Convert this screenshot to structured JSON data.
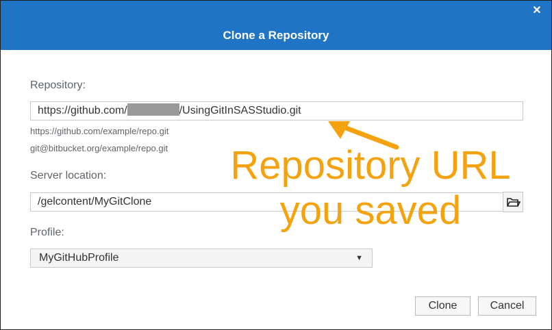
{
  "dialog": {
    "title": "Clone a Repository",
    "close_icon": "close-icon",
    "accent_color": "#1f74c6"
  },
  "repository": {
    "label": "Repository:",
    "value_prefix": "https://github.com/",
    "value_suffix": "/UsingGitInSASStudio.git",
    "hint_https": "https://github.com/example/repo.git",
    "hint_ssh": "git@bitbucket.org/example/repo.git"
  },
  "server_location": {
    "label": "Server location:",
    "value": "/gelcontent/MyGitClone",
    "browse_icon": "folder-icon"
  },
  "profile": {
    "label": "Profile:",
    "selected": "MyGitHubProfile"
  },
  "buttons": {
    "clone": "Clone",
    "cancel": "Cancel"
  },
  "annotation": {
    "line1": "Repository URL",
    "line2": "you saved",
    "color": "#f5a20f"
  }
}
